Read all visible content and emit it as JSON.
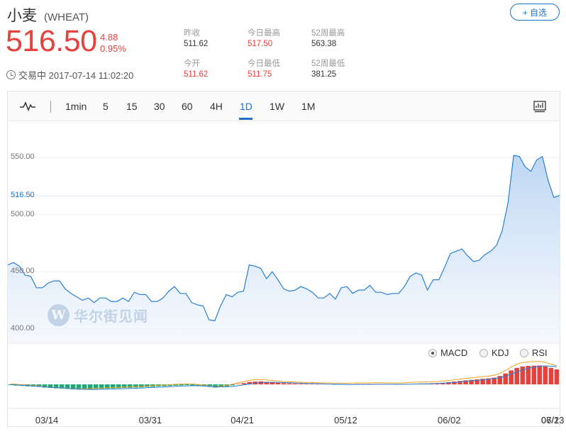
{
  "header": {
    "name": "小麦",
    "code": "(WHEAT)",
    "follow_label": "+ 自选",
    "price": "516.50",
    "change": "4.88",
    "change_pct": "0.95%",
    "status": "交易中 2017-07-14 11:02:20"
  },
  "stats": [
    {
      "label": "昨收",
      "value": "511.62"
    },
    {
      "label": "今开",
      "value": "511.62"
    },
    {
      "label": "今日最高",
      "value": "517.50"
    },
    {
      "label": "今日最低",
      "value": "511.75"
    },
    {
      "label": "52周最高",
      "value": "563.38"
    },
    {
      "label": "52周最低",
      "value": "381.25"
    }
  ],
  "tabs": [
    "1min",
    "5",
    "15",
    "30",
    "60",
    "4H",
    "1D",
    "1W",
    "1M"
  ],
  "active_tab": "1D",
  "indicators": [
    "MACD",
    "KDJ",
    "RSI"
  ],
  "active_indicator": "MACD",
  "watermark": {
    "letter": "W",
    "text": "华尔街见闻"
  },
  "colors": {
    "up": "#e5413d",
    "down": "#1fa67a",
    "line": "#2a7fd4",
    "accent": "#1a73c9"
  },
  "chart_data": {
    "type": "area",
    "yticks": [
      "550.00",
      "500.00",
      "450.00",
      "400.00"
    ],
    "ytick_values": [
      550,
      500,
      450,
      400
    ],
    "current_label": "516.50",
    "current_value": 516.5,
    "ylim": [
      388,
      580
    ],
    "xticks": [
      "03/14",
      "03/31",
      "04/21",
      "05/12",
      "06/02",
      "06/23",
      "07/1"
    ],
    "xtick_index": [
      7,
      25,
      41,
      59,
      77,
      95,
      111
    ],
    "values": [
      456,
      458,
      455,
      447,
      446,
      436,
      436,
      440,
      442,
      442,
      435,
      431,
      428,
      425,
      427,
      423,
      427,
      427,
      424,
      424,
      427,
      424,
      432,
      430,
      430,
      424,
      424,
      427,
      433,
      437,
      431,
      431,
      423,
      421,
      420,
      408,
      407,
      420,
      430,
      428,
      432,
      433,
      456,
      455,
      453,
      444,
      450,
      443,
      435,
      433,
      434,
      437,
      435,
      432,
      427,
      427,
      431,
      426,
      436,
      437,
      431,
      434,
      434,
      438,
      432,
      432,
      430,
      431,
      431,
      437,
      446,
      449,
      447,
      434,
      443,
      443,
      454,
      466,
      468,
      470,
      464,
      459,
      460,
      465,
      468,
      473,
      486,
      510,
      552,
      551,
      542,
      538,
      548,
      551,
      530,
      515,
      517
    ],
    "macd_hist": [
      -0.4,
      -0.6,
      -0.8,
      -1.0,
      -1.1,
      -1.3,
      -1.6,
      -1.8,
      -2.0,
      -2.1,
      -2.3,
      -2.5,
      -2.6,
      -2.6,
      -2.5,
      -2.3,
      -2.2,
      -2.1,
      -2.0,
      -1.9,
      -1.8,
      -1.7,
      -1.6,
      -1.5,
      -1.3,
      -1.2,
      -1.0,
      -0.9,
      -0.8,
      -0.6,
      -0.5,
      -0.4,
      -0.5,
      -0.7,
      -1.0,
      -1.3,
      -1.6,
      -1.4,
      -1.0,
      -0.5,
      0.1,
      0.6,
      1.2,
      1.4,
      1.5,
      1.3,
      1.1,
      0.8,
      0.6,
      0.5,
      0.4,
      0.3,
      0.2,
      0.2,
      0.1,
      0.0,
      0.0,
      -0.1,
      -0.1,
      -0.2,
      -0.1,
      0.0,
      0.0,
      0.0,
      0.1,
      0.1,
      0.0,
      0.0,
      -0.1,
      0.0,
      0.2,
      0.3,
      0.4,
      0.4,
      0.5,
      0.6,
      0.8,
      1.1,
      1.4,
      1.7,
      2.0,
      2.3,
      2.5,
      2.8,
      3.0,
      3.4,
      4.2,
      5.5,
      7.0,
      8.3,
      9.0,
      9.3,
      9.4,
      9.5,
      9.0,
      8.3,
      7.5
    ]
  }
}
